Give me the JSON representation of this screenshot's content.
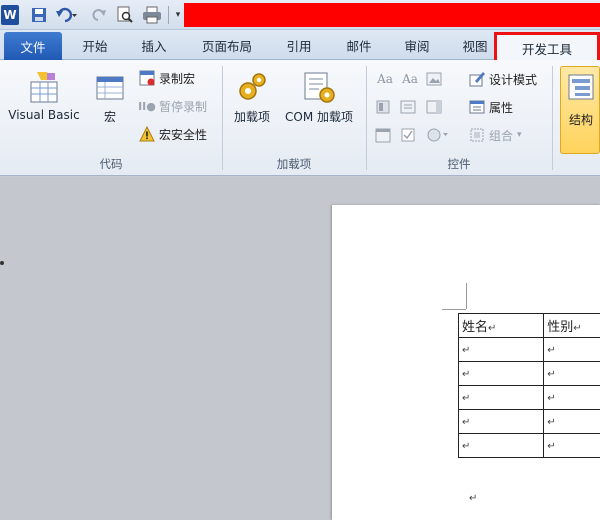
{
  "qat": {
    "app_icon": "W",
    "icons": [
      "save-icon",
      "undo-icon",
      "redo-icon",
      "print-preview-icon",
      "quick-print-icon",
      "customize-icon"
    ],
    "highlight_color": "#ff0000"
  },
  "tabs": {
    "file": "文件",
    "home": "开始",
    "insert": "插入",
    "page_layout": "页面布局",
    "references": "引用",
    "mailings": "邮件",
    "review": "审阅",
    "view": "视图",
    "developer": "开发工具"
  },
  "ribbon": {
    "code": {
      "label": "代码",
      "visual_basic": "Visual Basic",
      "macros": "宏",
      "record_macro": "录制宏",
      "pause_recording": "暂停录制",
      "macro_security": "宏安全性"
    },
    "addins": {
      "label": "加载项",
      "addins_btn": "加载项",
      "com_addins": "COM 加载项"
    },
    "controls": {
      "label": "控件",
      "aa1": "Aa",
      "aa2": "Aa",
      "design_mode": "设计模式",
      "properties": "属性",
      "group": "组合"
    },
    "xml": {
      "structure": "结构"
    }
  },
  "document": {
    "table": {
      "headers": [
        "姓名",
        "性别"
      ],
      "rows": 5,
      "para_mark": "↵"
    }
  },
  "colors": {
    "developer_tab_outline": "#ee1111",
    "file_tab": "#2b63c0"
  }
}
